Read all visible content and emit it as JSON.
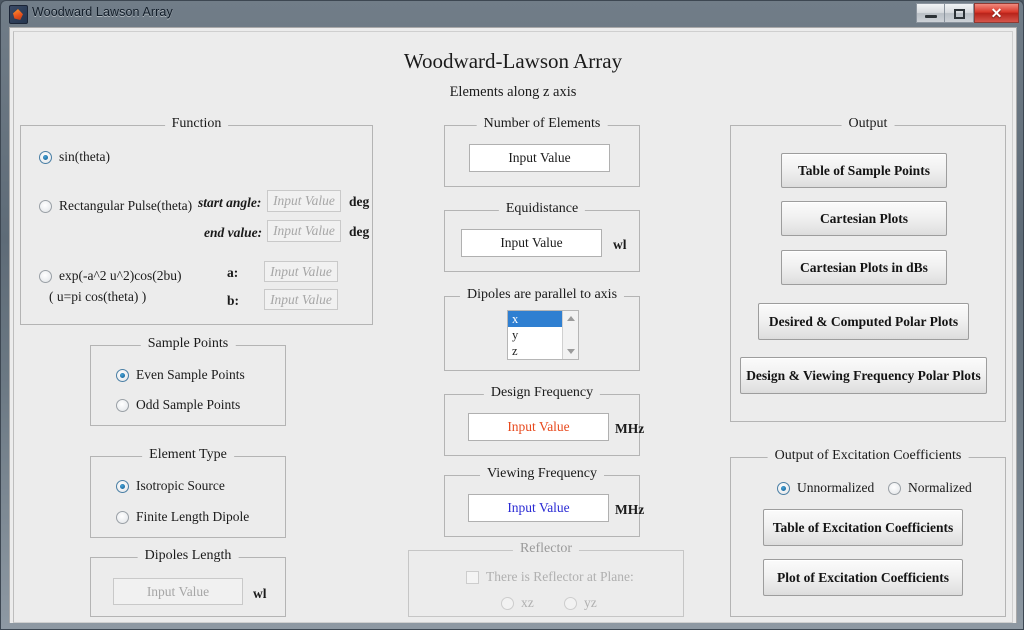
{
  "window": {
    "title": "Woodward Lawson Array",
    "icon": "matlab-icon",
    "controls": {
      "minimize": "minimize-icon",
      "maximize": "maximize-icon",
      "close": "✕"
    }
  },
  "heading": {
    "title": "Woodward-Lawson Array",
    "subtitle": "Elements along z axis"
  },
  "function_panel": {
    "legend": "Function",
    "options": [
      {
        "label": "sin(theta)",
        "selected": true
      },
      {
        "label": "Rectangular Pulse(theta)",
        "selected": false
      },
      {
        "label": "exp(-a^2 u^2)cos(2bu)",
        "selected": false
      }
    ],
    "sub_note": "( u=pi cos(theta)  )",
    "fields": [
      {
        "label": "start angle:",
        "value": "Input Value",
        "unit": "deg",
        "disabled": true
      },
      {
        "label": "end value:",
        "value": "Input Value",
        "unit": "deg",
        "disabled": true
      },
      {
        "label": "a:",
        "value": "Input Value",
        "unit": "",
        "disabled": true
      },
      {
        "label": "b:",
        "value": "Input Value",
        "unit": "",
        "disabled": true
      }
    ]
  },
  "sample_points_panel": {
    "legend": "Sample Points",
    "options": [
      {
        "label": "Even Sample Points",
        "selected": true
      },
      {
        "label": "Odd Sample Points",
        "selected": false
      }
    ]
  },
  "element_type_panel": {
    "legend": "Element Type",
    "options": [
      {
        "label": "Isotropic Source",
        "selected": true
      },
      {
        "label": "Finite Length Dipole",
        "selected": false
      }
    ]
  },
  "dipoles_length_panel": {
    "legend": "Dipoles Length",
    "value": "Input Value",
    "unit": "wl",
    "disabled": true
  },
  "number_of_elements_panel": {
    "legend": "Number of Elements",
    "value": "Input Value"
  },
  "equidistance_panel": {
    "legend": "Equidistance",
    "value": "Input Value",
    "unit": "wl"
  },
  "dipole_axis_panel": {
    "legend": "Dipoles are parallel to axis",
    "items": [
      "x",
      "y",
      "z"
    ],
    "selected": "x"
  },
  "design_frequency_panel": {
    "legend": "Design Frequency",
    "value": "Input Value",
    "unit": "MHz",
    "value_color": "#e8491d"
  },
  "viewing_frequency_panel": {
    "legend": "Viewing Frequency",
    "value": "Input Value",
    "unit": "MHz",
    "value_color": "#2b2bd4"
  },
  "reflector_panel": {
    "legend": "Reflector",
    "checkbox_label": "There is Reflector at Plane:",
    "checked": false,
    "options": [
      {
        "label": "xz",
        "selected": false
      },
      {
        "label": "yz",
        "selected": false
      }
    ],
    "disabled": true
  },
  "output_panel": {
    "legend": "Output",
    "buttons": [
      "Table of Sample Points",
      "Cartesian Plots",
      "Cartesian Plots in dBs",
      "Desired & Computed Polar Plots",
      "Design & Viewing Frequency Polar Plots"
    ]
  },
  "excitation_panel": {
    "legend": "Output of Excitation Coefficients",
    "options": [
      {
        "label": "Unnormalized",
        "selected": true
      },
      {
        "label": "Normalized",
        "selected": false
      }
    ],
    "buttons": [
      "Table of Excitation Coefficients",
      "Plot of Excitation Coefficients"
    ]
  },
  "colors": {
    "window_bg": "#ececec",
    "panel_border": "#b4b4b4",
    "accent_selected": "#1d6fa5",
    "listbox_select": "#2f7fd1"
  }
}
